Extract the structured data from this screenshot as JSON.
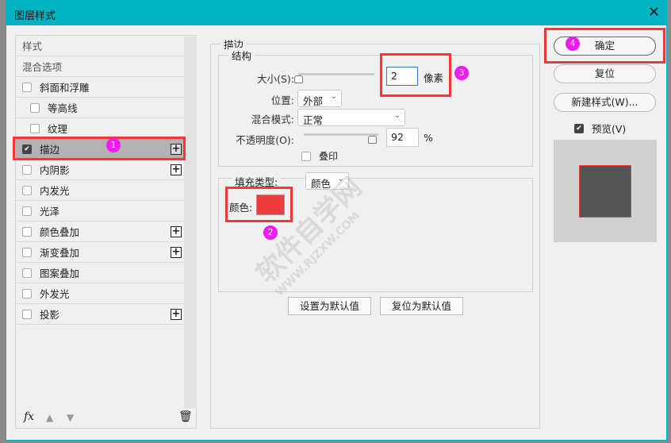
{
  "window": {
    "title": "图层样式"
  },
  "sidebar": {
    "items": [
      {
        "label": "样式",
        "checkbox": false,
        "plus": false
      },
      {
        "label": "混合选项",
        "checkbox": false,
        "plus": false
      },
      {
        "label": "斜面和浮雕",
        "checkbox": true,
        "checked": false,
        "plus": false
      },
      {
        "label": "等高线",
        "checkbox": true,
        "checked": false,
        "plus": false,
        "indent": true
      },
      {
        "label": "纹理",
        "checkbox": true,
        "checked": false,
        "plus": false,
        "indent": true
      },
      {
        "label": "描边",
        "checkbox": true,
        "checked": true,
        "plus": true,
        "selected": true
      },
      {
        "label": "内阴影",
        "checkbox": true,
        "checked": false,
        "plus": true
      },
      {
        "label": "内发光",
        "checkbox": true,
        "checked": false,
        "plus": false
      },
      {
        "label": "光泽",
        "checkbox": true,
        "checked": false,
        "plus": false
      },
      {
        "label": "颜色叠加",
        "checkbox": true,
        "checked": false,
        "plus": true
      },
      {
        "label": "渐变叠加",
        "checkbox": true,
        "checked": false,
        "plus": true
      },
      {
        "label": "图案叠加",
        "checkbox": true,
        "checked": false,
        "plus": false
      },
      {
        "label": "外发光",
        "checkbox": true,
        "checked": false,
        "plus": false
      },
      {
        "label": "投影",
        "checkbox": true,
        "checked": false,
        "plus": true
      }
    ],
    "fx_label": "fx"
  },
  "stroke": {
    "title": "描边",
    "structure_title": "结构",
    "size_label": "大小(S):",
    "size_value": "2",
    "size_unit": "像素",
    "size_fraction": 0.0,
    "position_label": "位置:",
    "position_value": "外部",
    "blend_label": "混合模式:",
    "blend_value": "正常",
    "opacity_label": "不透明度(O):",
    "opacity_value": "92",
    "opacity_unit": "%",
    "opacity_percent": 92,
    "overprint_label": "叠印",
    "fill_type_label": "填充类型:",
    "fill_type_value": "颜色",
    "color_label": "颜色:",
    "color": "#ee3b3b",
    "set_default": "设置为默认值",
    "reset_default": "复位为默认值"
  },
  "right": {
    "ok": "确定",
    "reset": "复位",
    "new_style": "新建样式(W)...",
    "preview_label": "预览(V)",
    "preview_checked": true
  },
  "annotations": [
    "1",
    "2",
    "3",
    "4"
  ],
  "watermark": {
    "text": "软件自学网",
    "url": "WWW.RJZXW.COM"
  }
}
